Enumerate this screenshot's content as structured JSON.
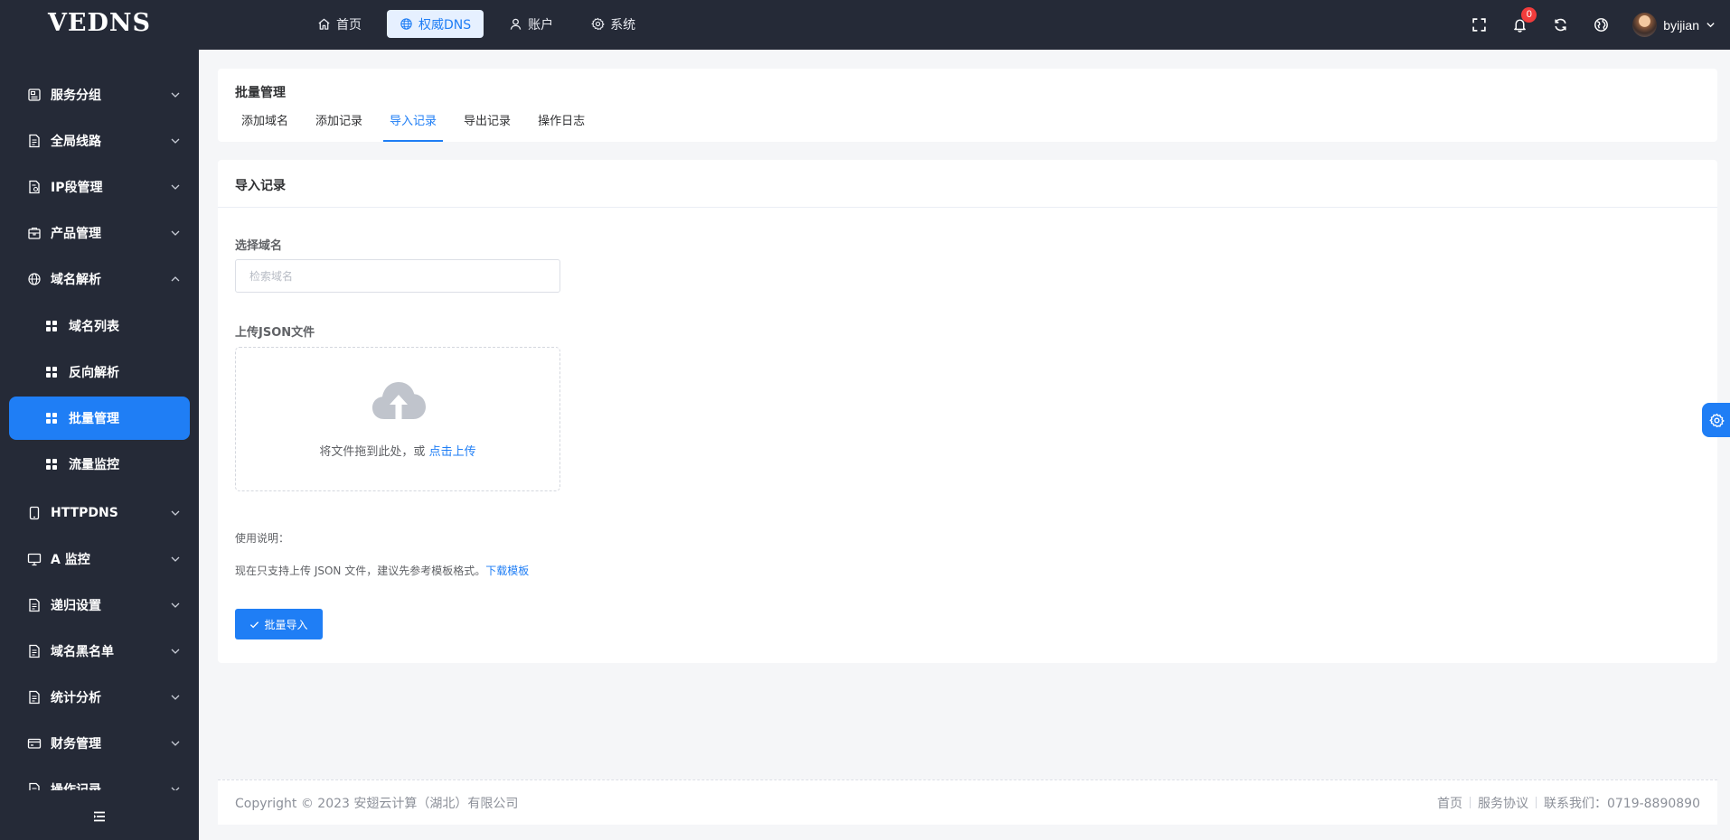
{
  "brand": "VEDNS",
  "top_nav": [
    {
      "label": "首页",
      "icon": "home-icon",
      "active": false
    },
    {
      "label": "权威DNS",
      "icon": "globe-icon",
      "active": true
    },
    {
      "label": "账户",
      "icon": "user-icon",
      "active": false
    },
    {
      "label": "系统",
      "icon": "settings-icon",
      "active": false
    }
  ],
  "header_right": {
    "notification_count": "0",
    "username": "byijian"
  },
  "sidebar": {
    "items": [
      {
        "label": "服务分组",
        "icon": "server-group-icon"
      },
      {
        "label": "全局线路",
        "icon": "document-icon"
      },
      {
        "label": "IP段管理",
        "icon": "ip-document-icon"
      },
      {
        "label": "产品管理",
        "icon": "package-icon"
      },
      {
        "label": "域名解析",
        "icon": "globe-icon",
        "expanded": true
      },
      {
        "label": "HTTPDNS",
        "icon": "tablet-icon"
      },
      {
        "label": "A 监控",
        "icon": "monitor-icon"
      },
      {
        "label": "递归设置",
        "icon": "document-icon"
      },
      {
        "label": "域名黑名单",
        "icon": "document-icon"
      },
      {
        "label": "统计分析",
        "icon": "document-icon"
      },
      {
        "label": "财务管理",
        "icon": "wallet-icon"
      },
      {
        "label": "操作记录",
        "icon": "document-icon"
      }
    ],
    "sub_items": [
      {
        "label": "域名列表",
        "active": false
      },
      {
        "label": "反向解析",
        "active": false
      },
      {
        "label": "批量管理",
        "active": true
      },
      {
        "label": "流量监控",
        "active": false
      }
    ]
  },
  "page": {
    "title": "批量管理",
    "tabs": [
      "添加域名",
      "添加记录",
      "导入记录",
      "导出记录",
      "操作日志"
    ],
    "active_tab": "导入记录"
  },
  "import_form": {
    "section_title": "导入记录",
    "domain_label": "选择域名",
    "domain_placeholder": "检索域名",
    "upload_label": "上传JSON文件",
    "upload_text": "将文件拖到此处，或",
    "upload_link": "点击上传",
    "usage_title": "使用说明：",
    "usage_text": "现在只支持上传 JSON 文件，建议先参考模板格式。",
    "template_link": "下载模板",
    "submit_label": "批量导入"
  },
  "footer": {
    "copyright": "Copyright © 2023 安翅云计算（湖北）有限公司",
    "links": [
      "首页",
      "服务协议",
      "联系我们：0719-8890890"
    ]
  },
  "colors": {
    "sidebar_bg": "#252a37",
    "accent": "#1f7ef5",
    "badge": "#f23c3c",
    "page_bg": "#f5f6f8"
  }
}
